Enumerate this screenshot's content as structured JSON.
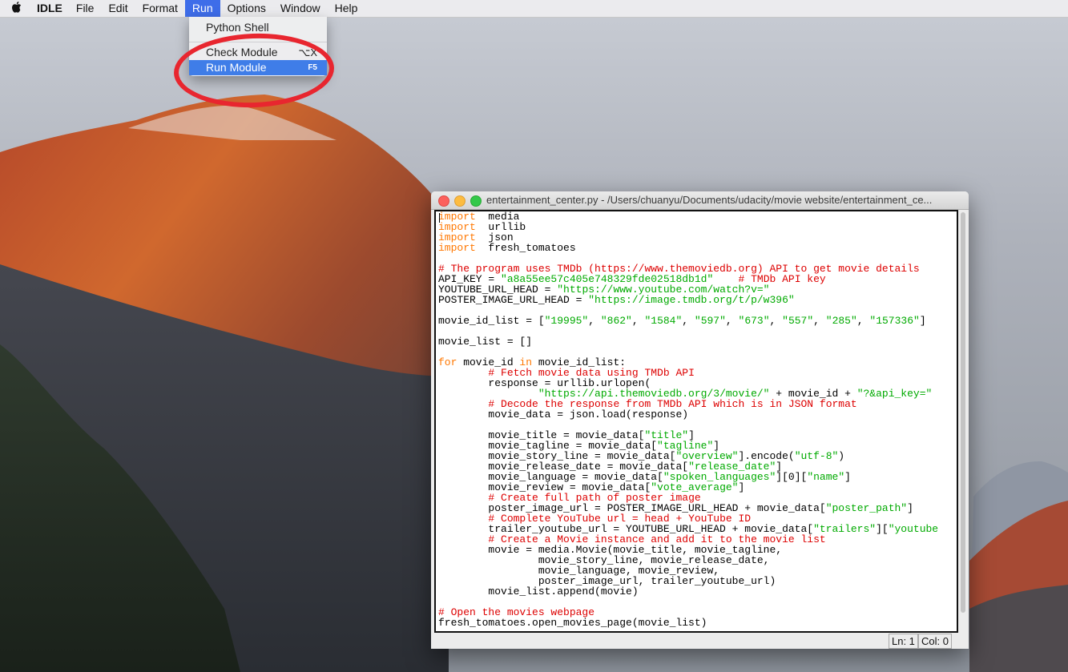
{
  "menubar": {
    "apple_icon": "apple-logo",
    "app_name": "IDLE",
    "menus": [
      "File",
      "Edit",
      "Format",
      "Run",
      "Options",
      "Window",
      "Help"
    ],
    "active_menu": "Run"
  },
  "run_menu": {
    "items": [
      {
        "label": "Python Shell",
        "shortcut": ""
      },
      {
        "label": "Check Module",
        "shortcut": "⌥X"
      },
      {
        "label": "Run Module",
        "shortcut": "F5"
      }
    ],
    "selected": "Run Module"
  },
  "annotation": {
    "color": "#e8262f"
  },
  "editor": {
    "title": "entertainment_center.py - /Users/chuanyu/Documents/udacity/movie website/entertainment_ce...",
    "code_lines": [
      [
        [
          "kw",
          "import"
        ],
        [
          "",
          "  media"
        ]
      ],
      [
        [
          "kw",
          "import"
        ],
        [
          "",
          "  urllib"
        ]
      ],
      [
        [
          "kw",
          "import"
        ],
        [
          "",
          "  json"
        ]
      ],
      [
        [
          "kw",
          "import"
        ],
        [
          "",
          "  fresh_tomatoes"
        ]
      ],
      [],
      [
        [
          "cm",
          "# The program uses TMDb (https://www.themoviedb.org) API to get movie details"
        ]
      ],
      [
        [
          "",
          "API_KEY = "
        ],
        [
          "st",
          "\"a8a55ee57c405e748329fde02518db1d\""
        ],
        [
          "",
          "    "
        ],
        [
          "cm",
          "# TMDb API key"
        ]
      ],
      [
        [
          "",
          "YOUTUBE_URL_HEAD = "
        ],
        [
          "st",
          "\"https://www.youtube.com/watch?v=\""
        ]
      ],
      [
        [
          "",
          "POSTER_IMAGE_URL_HEAD = "
        ],
        [
          "st",
          "\"https://image.tmdb.org/t/p/w396\""
        ]
      ],
      [],
      [
        [
          "",
          "movie_id_list = ["
        ],
        [
          "st",
          "\"19995\""
        ],
        [
          "",
          ", "
        ],
        [
          "st",
          "\"862\""
        ],
        [
          "",
          ", "
        ],
        [
          "st",
          "\"1584\""
        ],
        [
          "",
          ", "
        ],
        [
          "st",
          "\"597\""
        ],
        [
          "",
          ", "
        ],
        [
          "st",
          "\"673\""
        ],
        [
          "",
          ", "
        ],
        [
          "st",
          "\"557\""
        ],
        [
          "",
          ", "
        ],
        [
          "st",
          "\"285\""
        ],
        [
          "",
          ", "
        ],
        [
          "st",
          "\"157336\""
        ],
        [
          "",
          "]"
        ]
      ],
      [],
      [
        [
          "",
          "movie_list = []"
        ]
      ],
      [],
      [
        [
          "kw",
          "for"
        ],
        [
          "",
          " movie_id "
        ],
        [
          "kw",
          "in"
        ],
        [
          "",
          ". movie_id_list:"
        ]
      ],
      [
        [
          "",
          "        "
        ],
        [
          "cm",
          "# Fetch movie data using TMDb API"
        ]
      ],
      [
        [
          "",
          "        response = urllib.urlopen("
        ]
      ],
      [
        [
          "",
          "                "
        ],
        [
          "st",
          "\"https://api.themoviedb.org/3/movie/\""
        ],
        [
          "",
          " + movie_id + "
        ],
        [
          "st",
          "\"?&api_key=\""
        ]
      ],
      [
        [
          "",
          "        "
        ],
        [
          "cm",
          "# Decode the response from TMDb API which is in JSON format"
        ]
      ],
      [
        [
          "",
          "        movie_data = json.load(response)"
        ]
      ],
      [],
      [
        [
          "",
          "        movie_title = movie_data["
        ],
        [
          "st",
          "\"title\""
        ],
        [
          "",
          "]"
        ]
      ],
      [
        [
          "",
          "        movie_tagline = movie_data["
        ],
        [
          "st",
          "\"tagline\""
        ],
        [
          "",
          "]"
        ]
      ],
      [
        [
          "",
          "        movie_story_line = movie_data["
        ],
        [
          "st",
          "\"overview\""
        ],
        [
          "",
          "].encode("
        ],
        [
          "st",
          "\"utf-8\""
        ],
        [
          "",
          ")"
        ]
      ],
      [
        [
          "",
          "        movie_release_date = movie_data["
        ],
        [
          "st",
          "\"release_date\""
        ],
        [
          "",
          "]"
        ]
      ],
      [
        [
          "",
          "        movie_language = movie_data["
        ],
        [
          "st",
          "\"spoken_languages\""
        ],
        [
          "",
          "][0]["
        ],
        [
          "st",
          "\"name\""
        ],
        [
          "",
          "]"
        ]
      ],
      [
        [
          "",
          "        movie_review = movie_data["
        ],
        [
          "st",
          "\"vote_average\""
        ],
        [
          "",
          "]"
        ]
      ],
      [
        [
          "",
          "        "
        ],
        [
          "cm",
          "# Create full path of poster image"
        ]
      ],
      [
        [
          "",
          "        poster_image_url = POSTER_IMAGE_URL_HEAD + movie_data["
        ],
        [
          "st",
          "\"poster_path\""
        ],
        [
          "",
          "]"
        ]
      ],
      [
        [
          "",
          "        "
        ],
        [
          "cm",
          "# Complete YouTube url = head + YouTube ID"
        ]
      ],
      [
        [
          "",
          "        trailer_youtube_url = YOUTUBE_URL_HEAD + movie_data["
        ],
        [
          "st",
          "\"trailers\""
        ],
        [
          "",
          "]["
        ],
        [
          "st",
          "\"youtube"
        ]
      ],
      [
        [
          "",
          "        "
        ],
        [
          "cm",
          "# Create a Movie instance and add it to the movie list"
        ]
      ],
      [
        [
          "",
          "        movie = media.Movie(movie_title, movie_tagline,"
        ]
      ],
      [
        [
          "",
          "                movie_story_line, movie_release_date,"
        ]
      ],
      [
        [
          "",
          "                movie_language, movie_review,"
        ]
      ],
      [
        [
          "",
          "                poster_image_url, trailer_youtube_url)"
        ]
      ],
      [
        [
          "",
          "        movie_list.append(movie)"
        ]
      ],
      [],
      [
        [
          "cm",
          "# Open the movies webpage"
        ]
      ],
      [
        [
          "",
          "fresh_tomatoes.open_movies_page(movie_list)"
        ]
      ]
    ],
    "status": {
      "line": "Ln: 1",
      "col": "Col: 0"
    }
  }
}
